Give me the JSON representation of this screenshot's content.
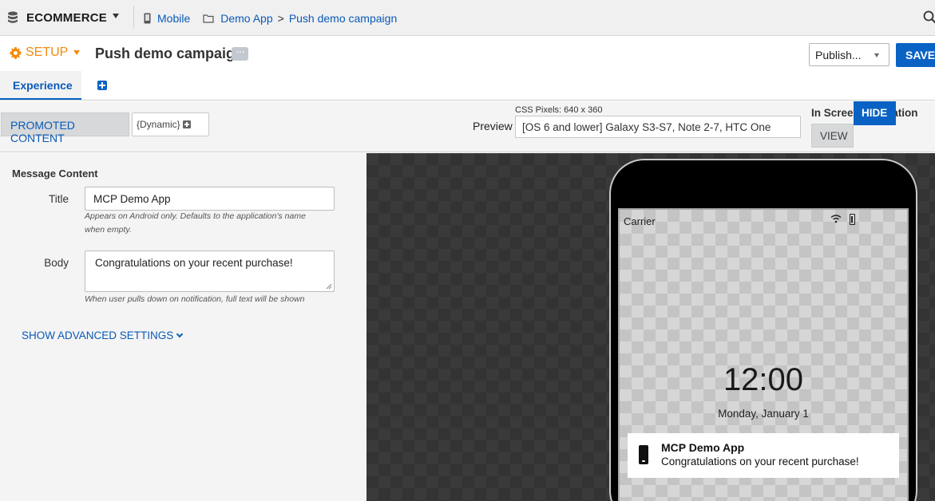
{
  "topbar": {
    "dataset": "ECOMMERCE",
    "breadcrumbs": [
      "Mobile",
      "Demo App",
      "Push demo campaign"
    ],
    "breadcrumb_separator": ">"
  },
  "header": {
    "setup_label": "SETUP",
    "campaign_title": "Push demo campaign",
    "ellipsis_label": "···",
    "publish_value": "Publish...",
    "save_label": "SAVE"
  },
  "tabs": {
    "experience_label": "Experience"
  },
  "toolbar": {
    "promoted_content_label": "PROMOTED CONTENT",
    "dynamic_label": "{Dynamic}",
    "css_pixels": "CSS Pixels: 640 x 360",
    "preview_label": "Preview",
    "preview_device": "[OS 6 and lower] Galaxy S3-S7, Note 2-7, HTC One",
    "in_screen_nav_label": "In Screen Navigation",
    "view_label": "VIEW",
    "hide_label": "HIDE"
  },
  "form": {
    "section_title": "Message Content",
    "title_label": "Title",
    "title_value": "MCP Demo App",
    "title_hint_line1": "Appears on Android only. Defaults to the application's name",
    "title_hint_line2": "when empty.",
    "body_label": "Body",
    "body_value": "Congratulations on your recent purchase!",
    "body_hint": "When user pulls down on notification, full text will be shown",
    "advanced_label": "SHOW ADVANCED SETTINGS"
  },
  "phone": {
    "carrier": "Carrier",
    "time": "12:00",
    "date": "Monday, January 1",
    "notification_title": "MCP Demo App",
    "notification_body": "Congratulations on your recent purchase!"
  },
  "colors": {
    "accent_blue": "#0a62c4",
    "link_blue": "#0a5ab8",
    "setup_orange": "#f28b0c"
  },
  "icons": [
    "database-icon",
    "mobile-icon",
    "folder-icon",
    "search-icon",
    "gear-icon",
    "plus-icon",
    "wifi-icon",
    "battery-icon",
    "phone-icon"
  ]
}
